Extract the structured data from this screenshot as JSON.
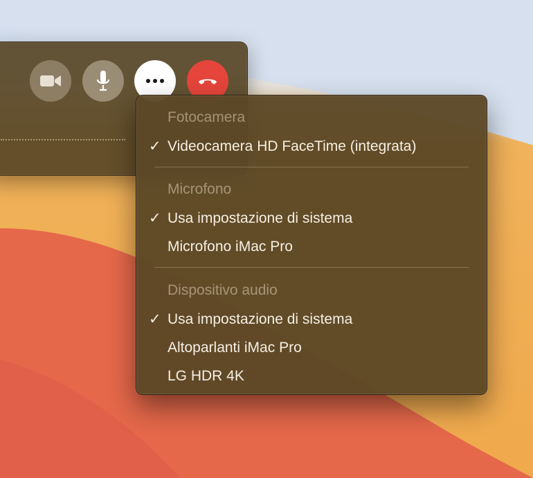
{
  "menu": {
    "sections": [
      {
        "header": "Fotocamera",
        "items": [
          {
            "label": "Videocamera HD FaceTime (integrata)",
            "checked": true
          }
        ]
      },
      {
        "header": "Microfono",
        "items": [
          {
            "label": "Usa impostazione di sistema",
            "checked": true
          },
          {
            "label": "Microfono iMac Pro",
            "checked": false
          }
        ]
      },
      {
        "header": "Dispositivo audio",
        "items": [
          {
            "label": "Usa impostazione di sistema",
            "checked": true
          },
          {
            "label": "Altoparlanti iMac Pro",
            "checked": false
          },
          {
            "label": "LG HDR 4K",
            "checked": false
          }
        ]
      }
    ],
    "checkmark": "✓"
  },
  "controls": [
    {
      "icon": "video-camera-icon"
    },
    {
      "icon": "microphone-icon"
    },
    {
      "icon": "more-options-icon"
    },
    {
      "icon": "end-call-icon"
    }
  ],
  "colors": {
    "menu_bg": "#5c4826",
    "menu_text": "#f6efe2",
    "end_call": "#e5453a"
  }
}
